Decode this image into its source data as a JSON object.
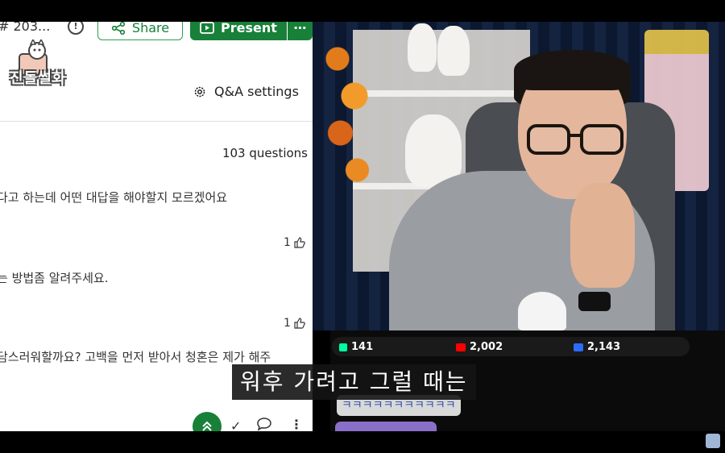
{
  "qa_panel": {
    "title": "# 203...",
    "share_label": "Share",
    "present_label": "Present",
    "more_label": "⋯",
    "logo_text": "진돌썰화",
    "settings_label": "Q&A settings",
    "question_count": "103 questions",
    "questions": [
      {
        "text": "다고 하는데 어떤 대답을 해야할지 모르겠어요",
        "likes": "1"
      },
      {
        "text": "는 방법좀 알려주세요.",
        "likes": "1"
      },
      {
        "text": "담스러워할까요? 고백을 먼저 받아서 청혼은 제가 해주"
      }
    ]
  },
  "stream": {
    "stats": [
      {
        "icon": "chzzk-icon",
        "value": "141",
        "color": "#00ffa3"
      },
      {
        "icon": "youtube-icon",
        "value": "2,002",
        "color": "#ff0000"
      },
      {
        "icon": "soop-icon",
        "value": "2,143",
        "color": "#2b6cff"
      }
    ],
    "chat_message": "ㅋㅋㅋㅋㅋㅋㅋㅋㅋㅋㅋㅋ"
  },
  "subtitle": "워후 가려고 그럴 때는",
  "colors": {
    "accent_green": "#188038",
    "background": "#000000"
  }
}
